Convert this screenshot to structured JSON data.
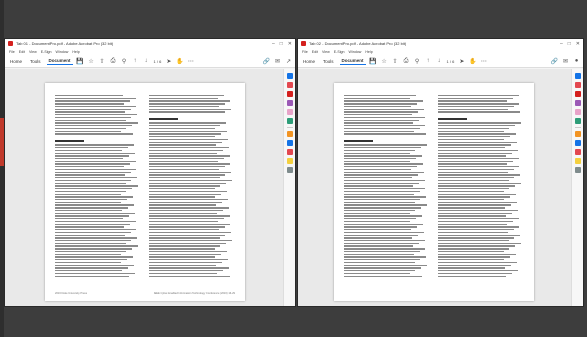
{
  "windows": [
    {
      "title": "Tab 01 - DocumentPro.pdf - Adobe Acrobat Pro (32 bit)",
      "menu": [
        "File",
        "Edit",
        "View",
        "E-Sign",
        "Window",
        "Help"
      ],
      "tabs": [
        "Home",
        "Tools",
        "Document"
      ],
      "page_indicator": "1 / 6",
      "footer_left": "2016 Duke University Press",
      "footer_right": "IEEE Cyber-Enabled Information Technology Conference  (2016) 16-29"
    },
    {
      "title": "Tab 02 - DocumentPro.pdf - Adobe Acrobat Pro (32 bit)",
      "menu": [
        "File",
        "Edit",
        "View",
        "E-Sign",
        "Window",
        "Help"
      ],
      "tabs": [
        "Home",
        "Tools",
        "Document"
      ],
      "page_indicator": "1 / 6"
    }
  ],
  "window_controls": {
    "minimize": "–",
    "maximize": "□",
    "close": "✕"
  },
  "toolbar_icons": [
    "save-icon",
    "star-icon",
    "upload-icon",
    "print-icon",
    "search-icon",
    "page-nav-up-icon",
    "page-nav-down-icon",
    "select-icon",
    "hand-icon",
    "zoom-out-icon",
    "zoom-in-icon",
    "more-icon",
    "link-icon",
    "mail-icon",
    "share-icon",
    "user-icon"
  ],
  "rail_tool_colors": [
    "#1473e6",
    "#e34850",
    "#d4201e",
    "#9b59b6",
    "#e8a3c9",
    "#2d9d78",
    "#f29423",
    "#1473e6",
    "#e34850",
    "#f4d03f",
    "#7f8c8d"
  ],
  "colors": {
    "accent": "#1473e6",
    "brand": "#d4201e"
  }
}
